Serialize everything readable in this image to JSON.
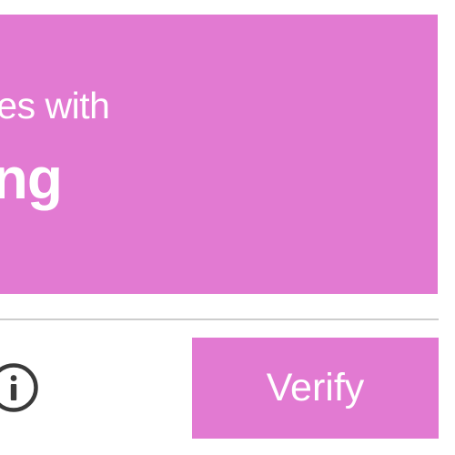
{
  "challenge": {
    "prompt_line1": "ges with",
    "prompt_line2": "ing"
  },
  "footer": {
    "info_icon": "info-icon",
    "verify_label": "Verify"
  },
  "colors": {
    "accent": "#e27ad2",
    "divider": "#cdcdcd",
    "icon": "#3a3a3a",
    "text_on_accent": "#ffffff"
  }
}
